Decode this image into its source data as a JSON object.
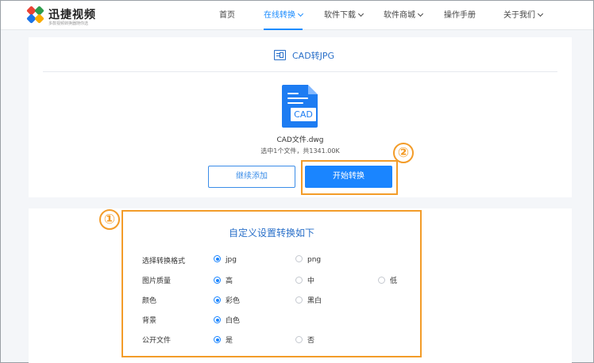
{
  "header": {
    "brand": "迅捷视频",
    "brand_sub": "多款视频转换器随你选",
    "nav": [
      {
        "label": "首页",
        "active": false
      },
      {
        "label": "在线转换",
        "active": true
      },
      {
        "label": "软件下载",
        "active": false
      },
      {
        "label": "软件商城",
        "active": false
      },
      {
        "label": "操作手册",
        "active": false
      },
      {
        "label": "关于我们",
        "active": false
      }
    ]
  },
  "tool": {
    "title": "CAD转JPG",
    "icon": "image-file-icon"
  },
  "file": {
    "icon_tag": "CAD",
    "name": "CAD文件.dwg",
    "summary": "选中1个文件，共1341.00K"
  },
  "actions": {
    "continue_label": "继续添加",
    "start_label": "开始转换"
  },
  "annotations": {
    "step1": "①",
    "step2": "②",
    "color": "#f39c29"
  },
  "settings": {
    "title": "自定义设置转换如下",
    "rows": [
      {
        "label": "选择转换格式",
        "options": [
          "jpg",
          "png"
        ],
        "selected": "jpg"
      },
      {
        "label": "图片质量",
        "options": [
          "高",
          "中",
          "低"
        ],
        "selected": "高"
      },
      {
        "label": "颜色",
        "options": [
          "彩色",
          "黑白"
        ],
        "selected": "彩色"
      },
      {
        "label": "背景",
        "options": [
          "白色"
        ],
        "selected": "白色"
      },
      {
        "label": "公开文件",
        "options": [
          "是",
          "否"
        ],
        "selected": "是"
      }
    ]
  },
  "colors": {
    "accent": "#1a85ff",
    "title_blue": "#2a70c9",
    "highlight": "#f39c29"
  }
}
